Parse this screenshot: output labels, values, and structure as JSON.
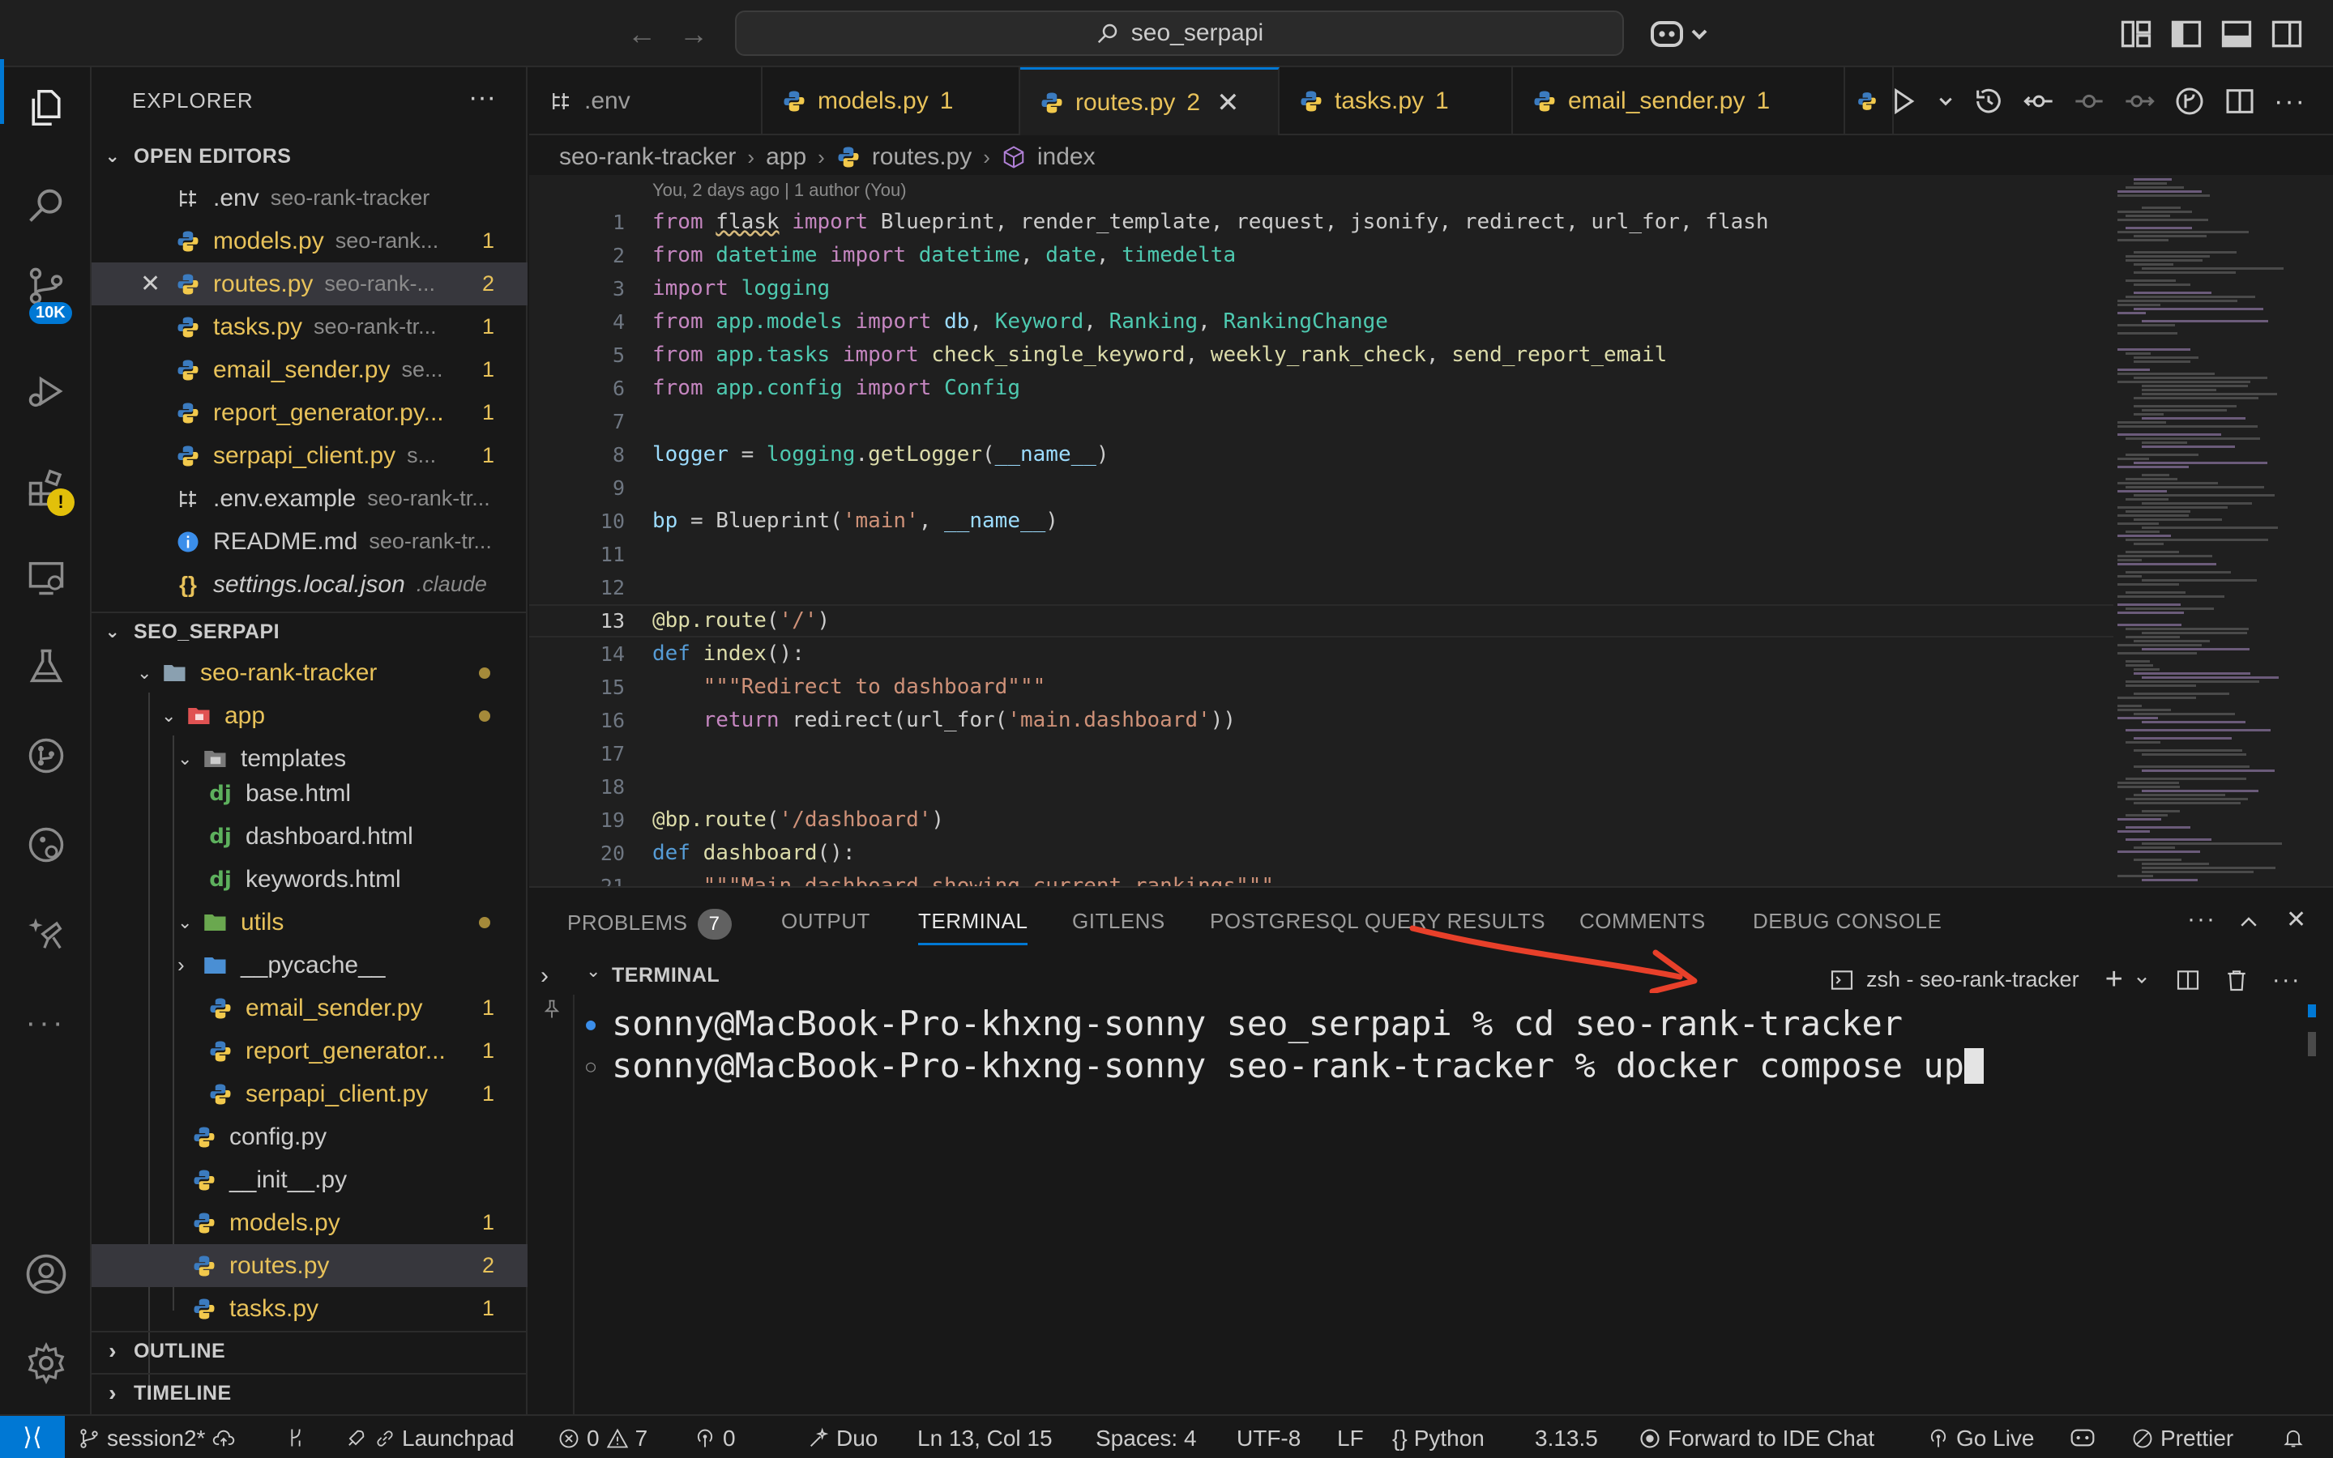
{
  "titlebar": {
    "search": "seo_serpapi"
  },
  "sidebar": {
    "title": "EXPLORER",
    "open_editors_label": "OPEN EDITORS",
    "open_editors": [
      {
        "name": ".env",
        "desc": "seo-rank-tracker",
        "count": "",
        "type": "env"
      },
      {
        "name": "models.py",
        "desc": "seo-rank...",
        "count": "1",
        "type": "py"
      },
      {
        "name": "routes.py",
        "desc": "seo-rank-...",
        "count": "2",
        "type": "py"
      },
      {
        "name": "tasks.py",
        "desc": "seo-rank-tr...",
        "count": "1",
        "type": "py"
      },
      {
        "name": "email_sender.py",
        "desc": "se...",
        "count": "1",
        "type": "py"
      },
      {
        "name": "report_generator.py...",
        "desc": "",
        "count": "1",
        "type": "py"
      },
      {
        "name": "serpapi_client.py",
        "desc": "s...",
        "count": "1",
        "type": "py"
      },
      {
        "name": ".env.example",
        "desc": "seo-rank-tr...",
        "count": "",
        "type": "env"
      },
      {
        "name": "README.md",
        "desc": "seo-rank-tr...",
        "count": "",
        "type": "info"
      },
      {
        "name": "settings.local.json",
        "desc": ".claude",
        "count": "",
        "type": "json"
      }
    ],
    "workspace_label": "SEO_SERPAPI",
    "tree": [
      {
        "name": "seo-rank-tracker",
        "count": ""
      },
      {
        "name": "app",
        "count": ""
      },
      {
        "name": "templates",
        "count": ""
      },
      {
        "name": "base.html",
        "count": ""
      },
      {
        "name": "dashboard.html",
        "count": ""
      },
      {
        "name": "keywords.html",
        "count": ""
      },
      {
        "name": "utils",
        "count": ""
      },
      {
        "name": "__pycache__",
        "count": ""
      },
      {
        "name": "email_sender.py",
        "count": "1"
      },
      {
        "name": "report_generator...",
        "count": "1"
      },
      {
        "name": "serpapi_client.py",
        "count": "1"
      },
      {
        "name": "config.py",
        "count": ""
      },
      {
        "name": "__init__.py",
        "count": ""
      },
      {
        "name": "models.py",
        "count": "1"
      },
      {
        "name": "routes.py",
        "count": "2"
      },
      {
        "name": "tasks.py",
        "count": "1"
      }
    ],
    "outline_label": "OUTLINE",
    "timeline_label": "TIMELINE",
    "activity_badge": "10K",
    "warn_badge": "!"
  },
  "tabs": [
    {
      "name": ".env",
      "count": ""
    },
    {
      "name": "models.py",
      "count": "1"
    },
    {
      "name": "routes.py",
      "count": "2"
    },
    {
      "name": "tasks.py",
      "count": "1"
    },
    {
      "name": "email_sender.py",
      "count": "1"
    }
  ],
  "breadcrumb": [
    "seo-rank-tracker",
    "app",
    "routes.py",
    "index"
  ],
  "editor": {
    "blame": "You, 2 days ago | 1 author (You)",
    "line_numbers": [
      "1",
      "2",
      "3",
      "4",
      "5",
      "6",
      "7",
      "8",
      "9",
      "10",
      "11",
      "12",
      "13",
      "14",
      "15",
      "16",
      "17",
      "18",
      "19",
      "20",
      "21"
    ]
  },
  "panel": {
    "tabs": [
      "PROBLEMS",
      "OUTPUT",
      "TERMINAL",
      "GITLENS",
      "POSTGRESQL QUERY RESULTS",
      "COMMENTS",
      "DEBUG CONSOLE"
    ],
    "problems_count": "7",
    "terminal_title": "TERMINAL",
    "terminal_name": "zsh - seo-rank-tracker",
    "lines": [
      "sonny@MacBook-Pro-khxng-sonny seo_serpapi % cd seo-rank-tracker",
      "sonny@MacBook-Pro-khxng-sonny seo-rank-tracker % docker compose up"
    ]
  },
  "statusbar": {
    "branch": "session2*",
    "launchpad": "Launchpad",
    "errors": "0",
    "warnings": "7",
    "ports": "0",
    "duo": "Duo",
    "position": "Ln 13, Col 15",
    "spaces": "Spaces: 4",
    "encoding": "UTF-8",
    "eol": "LF",
    "language": "Python",
    "version": "3.13.5",
    "forward": "Forward to IDE Chat",
    "golive": "Go Live",
    "prettier": "Prettier"
  },
  "colors": {
    "accent": "#0078d4",
    "modified": "#e8c25a"
  }
}
